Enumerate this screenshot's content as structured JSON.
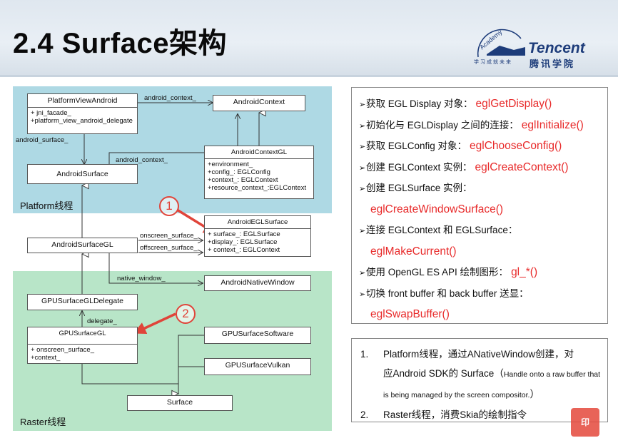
{
  "header": {
    "title": "2.4 Surface架构",
    "logo": {
      "brand": "Tencent",
      "sub": "腾讯学院",
      "ring": "Academy",
      "slogan": "学习成就未来"
    }
  },
  "diagram": {
    "zones": {
      "platform": "Platform线程",
      "raster": "Raster线程"
    },
    "classes": {
      "platform_view_android": {
        "name": "PlatformViewAndroid",
        "members": [
          "+ jni_facade_",
          "+platform_view_android_delegate"
        ]
      },
      "android_context": {
        "name": "AndroidContext"
      },
      "android_context_gl": {
        "name": "AndroidContextGL",
        "members": [
          "+environment_",
          "+config_: EGLConfig",
          "+context_: EGLContext",
          "+resource_context_:EGLContext"
        ]
      },
      "android_surface": {
        "name": "AndroidSurface"
      },
      "android_surface_gl": {
        "name": "AndroidSurfaceGL"
      },
      "android_egl_surface": {
        "name": "AndroidEGLSurface",
        "members": [
          "+ surface_: EGLSurface",
          "+display_: EGLSurface",
          "+ context_: EGLContext"
        ]
      },
      "android_native_window": {
        "name": "AndroidNativeWindow"
      },
      "gpu_surface_gl_delegate": {
        "name": "GPUSurfaceGLDelegate"
      },
      "gpu_surface_gl": {
        "name": "GPUSurfaceGL",
        "members": [
          "+ onscreen_surface_",
          "+context_"
        ]
      },
      "gpu_surface_software": {
        "name": "GPUSurfaceSoftware"
      },
      "gpu_surface_vulkan": {
        "name": "GPUSurfaceVulkan"
      },
      "surface": {
        "name": "Surface"
      }
    },
    "edge_labels": {
      "android_context_1": "android_context_",
      "android_surface_": "android_surface_",
      "android_context_2": "android_context_",
      "onscreen_surface_": "onscreen_surface_",
      "offscreen_surface_": "offscreen_surface_",
      "native_window_": "native_window_",
      "delegate_": "delegate_"
    },
    "markers": [
      "1",
      "2"
    ],
    "colors": {
      "platform_zone": "#aed9e4",
      "raster_zone": "#b8e5c8",
      "marker": "#e0443a"
    }
  },
  "steps": [
    {
      "text": "获取 EGL Display 对象：",
      "fn": "eglGetDisplay()"
    },
    {
      "text": "初始化与 EGLDisplay 之间的连接：",
      "fn": "eglInitialize()"
    },
    {
      "text": "获取 EGLConfig 对象：",
      "fn": "eglChooseConfig()"
    },
    {
      "text": "创建 EGLContext 实例：",
      "fn": "eglCreateContext()"
    },
    {
      "text": "创建 EGLSurface 实例：",
      "fn": ""
    },
    {
      "text": "",
      "fn": "eglCreateWindowSurface()"
    },
    {
      "text": "连接 EGLContext 和 EGLSurface：",
      "fn": ""
    },
    {
      "text": "",
      "fn": "eglMakeCurrent()"
    },
    {
      "text": "使用 OpenGL ES API 绘制图形：",
      "fn": "gl_*()"
    },
    {
      "text": "切换 front buffer 和 back buffer 送显：",
      "fn": ""
    },
    {
      "text": "",
      "fn": "eglSwapBuffer()"
    }
  ],
  "step_bullet": "➢",
  "notes": [
    {
      "num": "1.",
      "line1": "Platform线程，通过ANativeWindow创建，对",
      "line2": "应Android SDK的 Surface（",
      "small": "Handle onto a raw buffer that is being managed by the screen compositor.",
      "close": "）"
    },
    {
      "num": "2.",
      "line1": "Raster线程，消费Skia的绘制指令"
    }
  ]
}
